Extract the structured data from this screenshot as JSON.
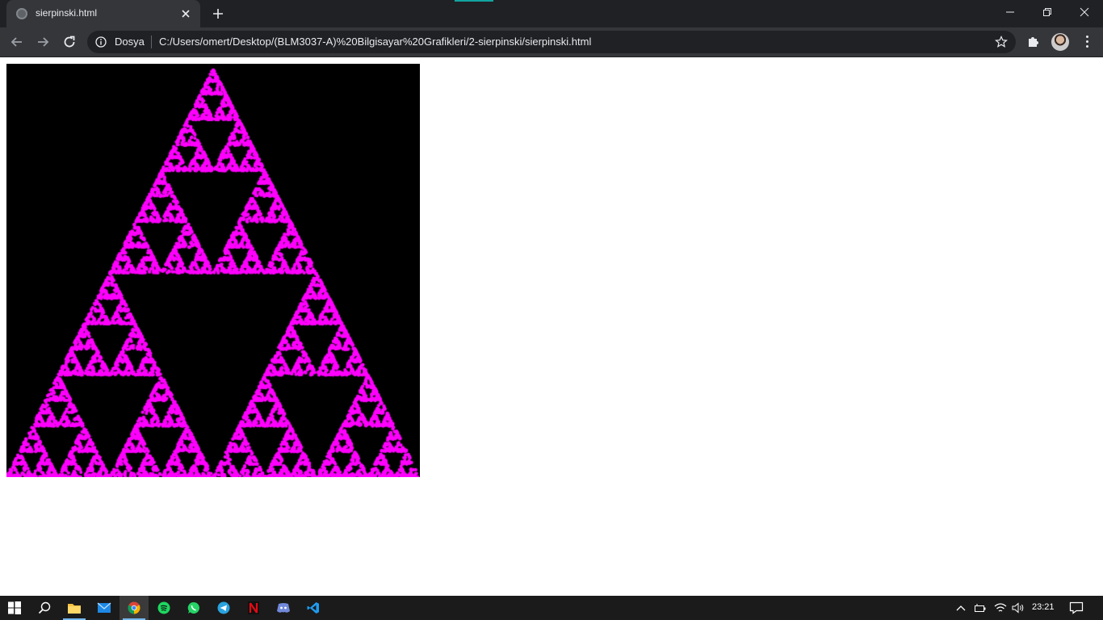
{
  "browser": {
    "tab_title": "sierpinski.html",
    "address_chip": "Dosya",
    "url": "C:/Users/omert/Desktop/(BLM3037-A)%20Bilgisayar%20Grafikleri/2-sierpinski/sierpinski.html",
    "icons": [
      "globe-icon",
      "close-icon",
      "plus-icon",
      "minimize-icon",
      "restore-icon",
      "window-close-icon",
      "back-icon",
      "forward-icon",
      "reload-icon",
      "info-icon",
      "star-icon",
      "puzzle-icon",
      "avatar",
      "menu-icon"
    ]
  },
  "page": {
    "canvas_background": "#000000",
    "fractal_color": "#ff00ff",
    "fractal": "Sierpinski triangle (chaos-game points)"
  },
  "taskbar": {
    "apps": [
      "windows-start-icon",
      "search-icon",
      "file-explorer-icon",
      "mail-icon",
      "chrome-icon",
      "spotify-icon",
      "whatsapp-icon",
      "telegram-icon",
      "netflix-icon",
      "discord-icon",
      "vscode-icon"
    ],
    "clock": "23:21",
    "tray_icons": [
      "chevron-up-icon",
      "battery-icon",
      "wifi-icon",
      "volume-icon",
      "notification-icon"
    ]
  }
}
